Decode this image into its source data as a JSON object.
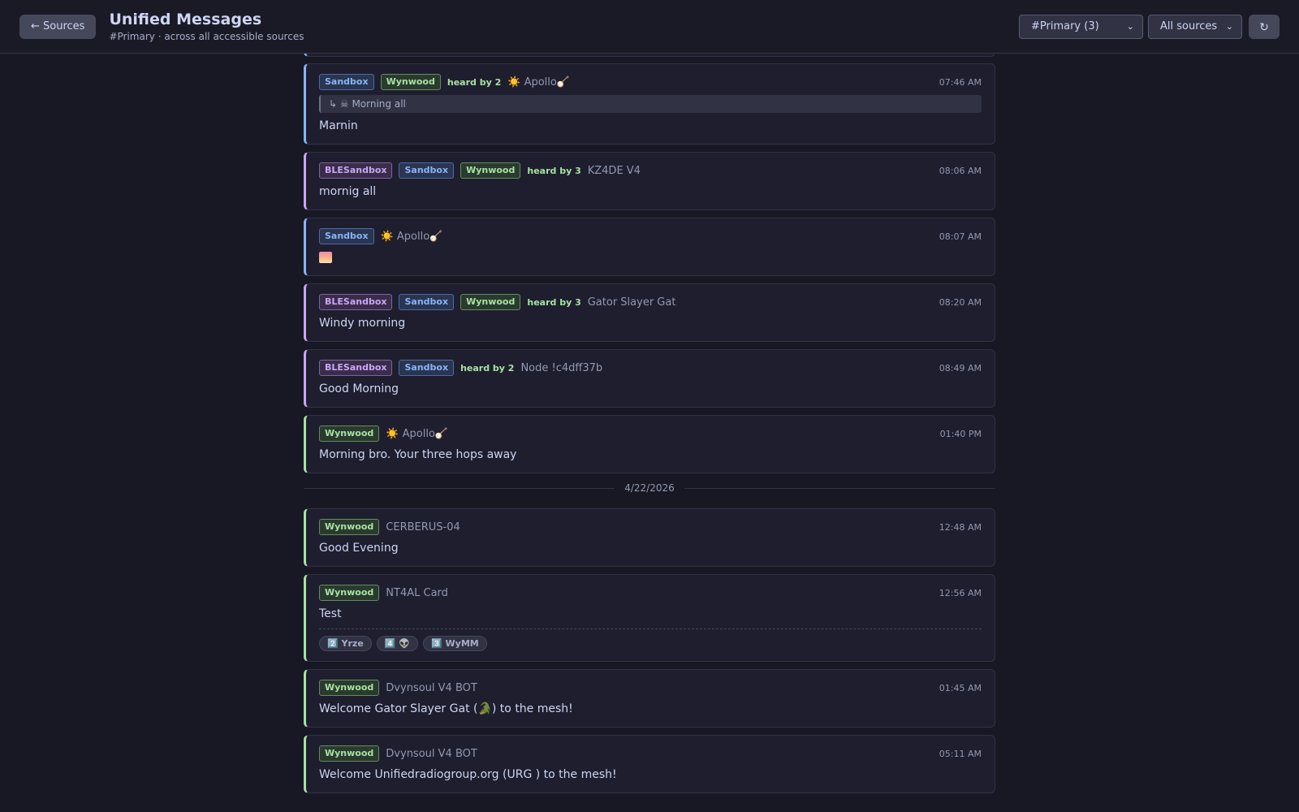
{
  "header": {
    "back_label": "← Sources",
    "title": "Unified Messages",
    "subtitle": "#Primary · across all accessible sources",
    "channel_select": "#Primary (3)",
    "source_select": "All sources",
    "refresh_label": "↻"
  },
  "messages": [
    {
      "tags": [
        "Sandbox",
        "Wynwood"
      ],
      "heard": "heard by 2",
      "sender": "☀️ Apollo🪕",
      "time": "07:46 AM",
      "reply": "↳ ☠ Morning all",
      "text": "Marnin"
    },
    {
      "tags": [
        "BLESandbox",
        "Sandbox",
        "Wynwood"
      ],
      "heard": "heard by 3",
      "sender": "KZ4DE V4",
      "time": "08:06 AM",
      "text": "mornig all"
    },
    {
      "tags": [
        "Sandbox"
      ],
      "sender": "☀️ Apollo🪕",
      "time": "08:07 AM",
      "text_icon": "sunrise-emoji"
    },
    {
      "tags": [
        "BLESandbox",
        "Sandbox",
        "Wynwood"
      ],
      "heard": "heard by 3",
      "sender": "Gator Slayer Gat",
      "time": "08:20 AM",
      "text": "Windy morning"
    },
    {
      "tags": [
        "BLESandbox",
        "Sandbox"
      ],
      "heard": "heard by 2",
      "sender": "Node !c4dff37b",
      "time": "08:49 AM",
      "text": "Good Morning"
    },
    {
      "tags": [
        "Wynwood"
      ],
      "sender": "☀️ Apollo🪕",
      "time": "01:40 PM",
      "text": "Morning bro. Your three hops away"
    },
    {
      "tags": [
        "Wynwood"
      ],
      "sender": "CERBERUS-04",
      "time": "12:48 AM",
      "text": "Good Evening"
    },
    {
      "tags": [
        "Wynwood"
      ],
      "sender": "NT4AL Card",
      "time": "12:56 AM",
      "text": "Test",
      "reactions": [
        "2️⃣ Yrze",
        "4️⃣ 👽",
        "3️⃣ WyMM"
      ]
    },
    {
      "tags": [
        "Wynwood"
      ],
      "sender": "Dvynsoul V4 BOT",
      "time": "01:45 AM",
      "text": "Welcome Gator Slayer Gat (🐊) to the mesh!"
    },
    {
      "tags": [
        "Wynwood"
      ],
      "sender": "Dvynsoul V4 BOT",
      "time": "05:11 AM",
      "text": "Welcome Unifiedradiogroup.org (URG ) to the mesh!"
    }
  ],
  "date_separator": "4/22/2026",
  "colors": {
    "sandbox": "#89b4fa",
    "wynwood": "#a6e3a1",
    "blesandbox": "#cba6f7"
  }
}
